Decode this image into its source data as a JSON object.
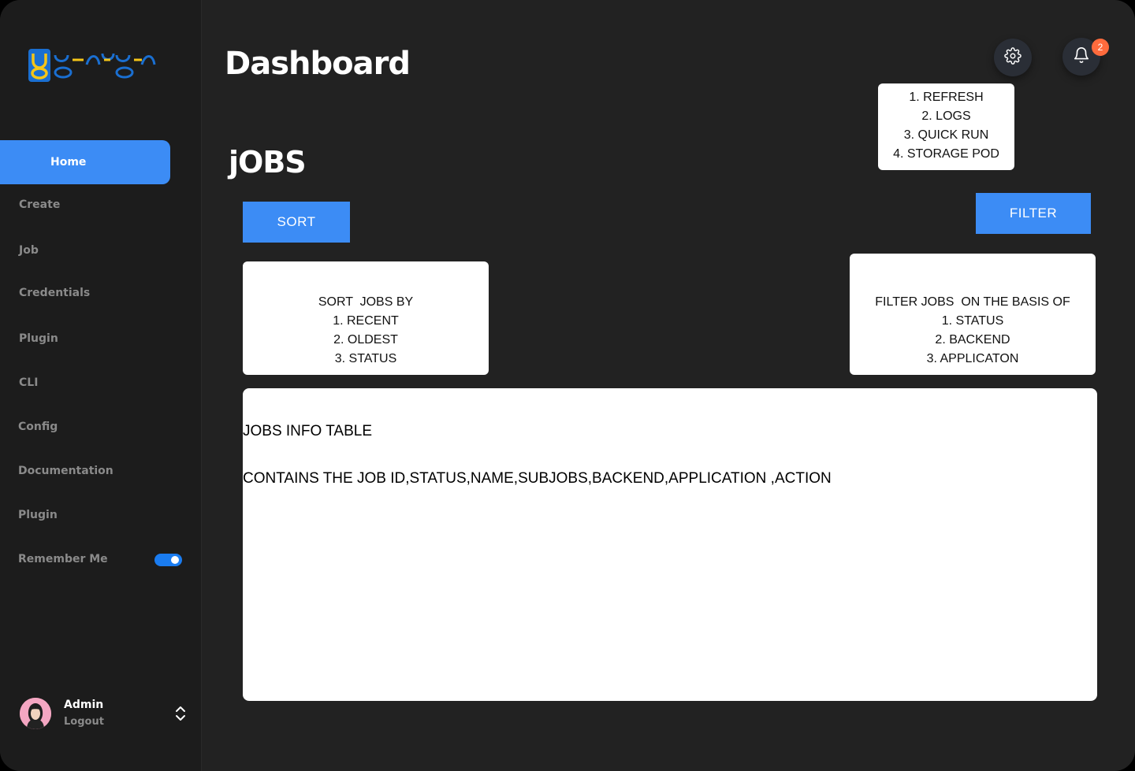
{
  "app": {
    "logo_text": "ganga"
  },
  "sidebar": {
    "items": [
      {
        "label": "Home"
      },
      {
        "label": "Create"
      },
      {
        "label": "Job"
      },
      {
        "label": "Credentials"
      },
      {
        "label": "Plugin"
      },
      {
        "label": "CLI"
      },
      {
        "label": "Config"
      },
      {
        "label": "Documentation"
      },
      {
        "label": "Plugin"
      },
      {
        "label": "Remember Me"
      }
    ],
    "remember_me_enabled": true
  },
  "user": {
    "name": "Admin",
    "logout_label": "Logout"
  },
  "header": {
    "title": "Dashboard",
    "notification_count": "2"
  },
  "settings_menu": {
    "items": [
      "1. REFRESH",
      "2. LOGS",
      "3. QUICK RUN",
      "4. STORAGE POD"
    ]
  },
  "main": {
    "section_title": "jOBS",
    "sort_label": "SORT",
    "filter_label": "FILTER",
    "sort_card": {
      "heading": "SORT  JOBS BY",
      "items": [
        "1. RECENT",
        "2. OLDEST",
        "3. STATUS"
      ]
    },
    "filter_card": {
      "heading": "FILTER JOBS  ON THE BASIS OF",
      "items": [
        "1. STATUS",
        "2. BACKEND",
        "3. APPLICATON"
      ]
    },
    "table_card": {
      "title": "JOBS INFO TABLE",
      "description": "CONTAINS THE JOB ID,STATUS,NAME,SUBJOBS,BACKEND,APPLICATION ,ACTION"
    }
  },
  "colors": {
    "accent": "#3c8cf5",
    "background": "#222222",
    "sidebar": "#1c1c1c",
    "badge": "#ff6b3d",
    "toggle": "#1a7cf0"
  }
}
